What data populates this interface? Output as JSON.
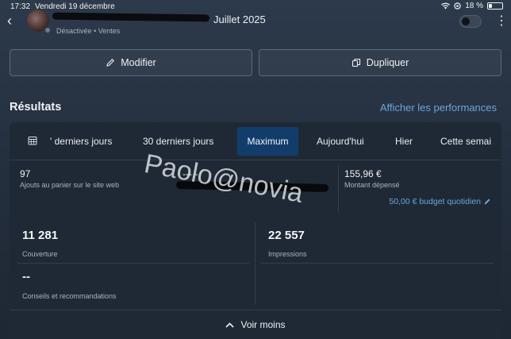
{
  "status_bar": {
    "time": "17:32",
    "date": "Vendredi 19 décembre",
    "battery_percent": "18 %",
    "battery_level": 0.18
  },
  "header": {
    "title_suffix": "Juillet 2025",
    "status": "Désactivée",
    "objective": "Ventes",
    "separator": "•",
    "toggle_on": false
  },
  "actions": {
    "edit_label": "Modifier",
    "duplicate_label": "Dupliquer"
  },
  "results": {
    "title": "Résultats",
    "performance_link": "Afficher les performances",
    "tabs": [
      {
        "label": "' derniers jours",
        "active": false
      },
      {
        "label": "30 derniers jours",
        "active": false
      },
      {
        "label": "Maximum",
        "active": true
      },
      {
        "label": "Aujourd'hui",
        "active": false
      },
      {
        "label": "Hier",
        "active": false
      },
      {
        "label": "Cette semai",
        "active": false
      }
    ],
    "metrics": {
      "add_to_cart": {
        "value": "97",
        "label": "Ajouts au panier sur le site web"
      },
      "middle_value": "--- -",
      "amount_spent": {
        "value": "155,96 €",
        "label": "Montant dépensé"
      },
      "daily_budget": "50,00 € budget quotidien",
      "reach": {
        "value": "11 281",
        "label": "Couverture"
      },
      "impressions": {
        "value": "22 557",
        "label": "Impressions"
      },
      "tips": {
        "value": "--",
        "label": "Conseils et recommandations"
      }
    },
    "see_less": "Voir moins"
  },
  "watermark": "Paolo@novia",
  "colors": {
    "accent_link": "#6ba5de",
    "active_tab": "#123d6b",
    "card_bg": "#1f2935"
  }
}
